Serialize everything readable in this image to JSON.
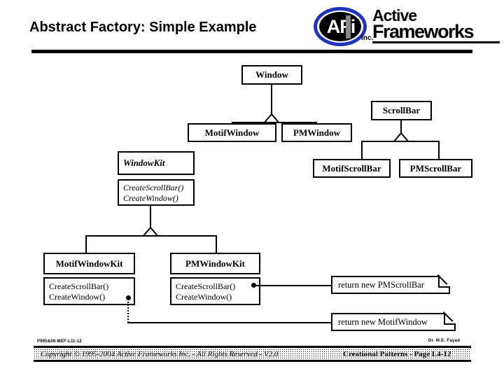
{
  "slide": {
    "title": "Abstract Factory: Simple Example"
  },
  "logo": {
    "monogram": "AFi",
    "word1": "Active",
    "word2": "Frameworks",
    "suffix": "Inc."
  },
  "diagram": {
    "classes": [
      {
        "name": "Window",
        "operations": []
      },
      {
        "name": "ScrollBar",
        "operations": []
      },
      {
        "name": "MotifWindow",
        "operations": []
      },
      {
        "name": "PMWindow",
        "operations": []
      },
      {
        "name": "MotifScrollBar",
        "operations": []
      },
      {
        "name": "PMScrollBar",
        "operations": []
      },
      {
        "name": "WindowKit",
        "abstract": true,
        "operations": [
          "CreateScrollBar()",
          "CreateWindow()"
        ]
      },
      {
        "name": "MotifWindowKit",
        "abstract": false,
        "operations": [
          "CreateScrollBar()",
          "CreateWindow()"
        ]
      },
      {
        "name": "PMWindowKit",
        "abstract": false,
        "operations": [
          "CreateScrollBar()",
          "CreateWindow()"
        ]
      }
    ],
    "notes": [
      {
        "text": "return  new PMScrollBar"
      },
      {
        "text": "return  new MotifWindow"
      }
    ]
  },
  "footer": {
    "code": "P995&06-MEF-L11-12",
    "author": "Dr. M.E. Fayad",
    "copyright": "Copyright © 1995-2004 Active Frameworks Inc.  -  All Rights Reserved - V2.0",
    "page": "Creational Patterns - Page L4-12"
  }
}
